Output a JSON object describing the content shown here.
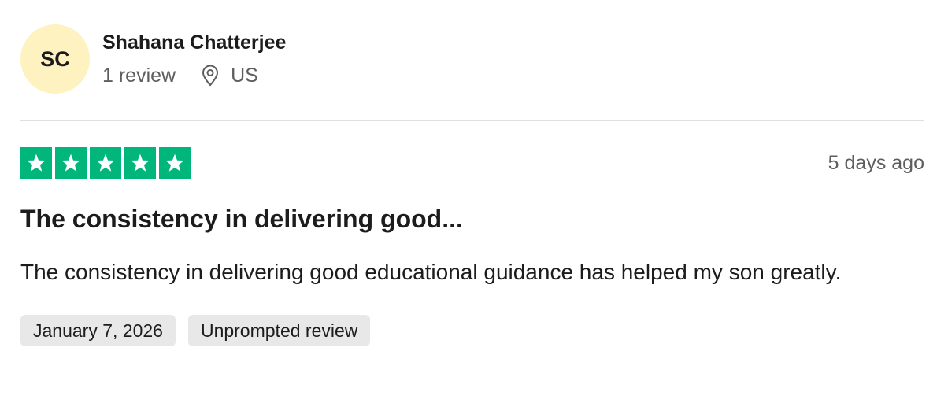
{
  "reviewer": {
    "initials": "SC",
    "name": "Shahana Chatterjee",
    "review_count": "1 review",
    "location": "US",
    "location_icon": "location-pin-icon",
    "avatar_color": "#fdf2c0"
  },
  "review": {
    "rating": 5,
    "rating_max": 5,
    "star_color": "#00b67a",
    "relative_date": "5 days ago",
    "title": "The consistency in delivering good...",
    "body": "The consistency in delivering good educational guidance has helped my son greatly.",
    "tags": [
      "January 7, 2026",
      "Unprompted review"
    ]
  }
}
